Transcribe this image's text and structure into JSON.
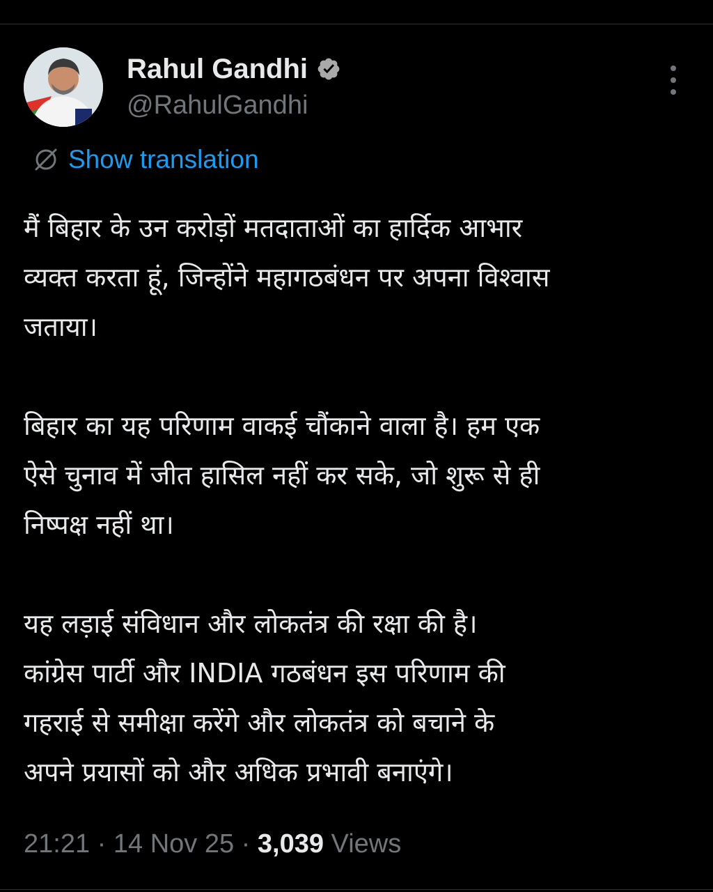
{
  "author": {
    "display_name": "Rahul Gandhi",
    "handle": "@RahulGandhi",
    "verified": true
  },
  "translate": {
    "label": "Show translation",
    "icon": "translate-globe-icon"
  },
  "tweet": {
    "paragraphs": [
      {
        "lines": [
          "मैं बिहार के उन करोड़ों मतदाताओं का हार्दिक आभार",
          "व्यक्त करता हूं, जिन्होंने महागठबंधन पर अपना विश्वास",
          "जताया।"
        ]
      },
      {
        "lines": [
          "बिहार का यह परिणाम वाकई चौंकाने वाला है। हम एक",
          "ऐसे चुनाव में जीत हासिल नहीं कर सके, जो शुरू से ही",
          "निष्पक्ष नहीं था।"
        ]
      },
      {
        "lines": [
          "यह लड़ाई संविधान और लोकतंत्र की रक्षा की है।",
          "कांग्रेस पार्टी और INDIA गठबंधन इस परिणाम की",
          "गहराई से समीक्षा करेंगे और लोकतंत्र को बचाने के",
          "अपने प्रयासों को और अधिक प्रभावी बनाएंगे।"
        ]
      }
    ]
  },
  "meta": {
    "time": "21:21",
    "separator": "·",
    "date": "14 Nov 25",
    "views_count": "3,039",
    "views_label": "Views"
  },
  "colors": {
    "background": "#000000",
    "text": "#e7e9ea",
    "secondary": "#71767b",
    "link": "#1d9bf0",
    "divider": "#2f3336"
  }
}
